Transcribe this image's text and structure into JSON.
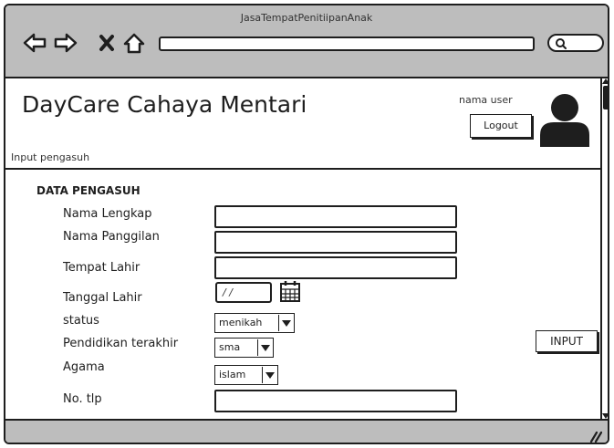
{
  "window": {
    "title": "JasaTempatPenitiipanAnak"
  },
  "toolbar": {
    "url_value": ""
  },
  "header": {
    "site_title": "DayCare Cahaya Mentari",
    "breadcrumb": "Input pengasuh",
    "user_name": "nama user",
    "logout_label": "Logout"
  },
  "form": {
    "section_title": "DATA PENGASUH",
    "nama_lengkap_label": "Nama Lengkap",
    "nama_panggilan_label": "Nama Panggilan",
    "tempat_lahir_label": "Tempat Lahir",
    "tanggal_lahir_label": "Tanggal Lahir",
    "tanggal_lahir_value": "/ /",
    "status_label": "status",
    "status_value": "menikah",
    "pendidikan_label": "Pendidikan terakhir",
    "pendidikan_value": "sma",
    "agama_label": "Agama",
    "agama_value": "islam",
    "no_tlp_label": "No. tlp",
    "submit_label": "INPUT"
  }
}
